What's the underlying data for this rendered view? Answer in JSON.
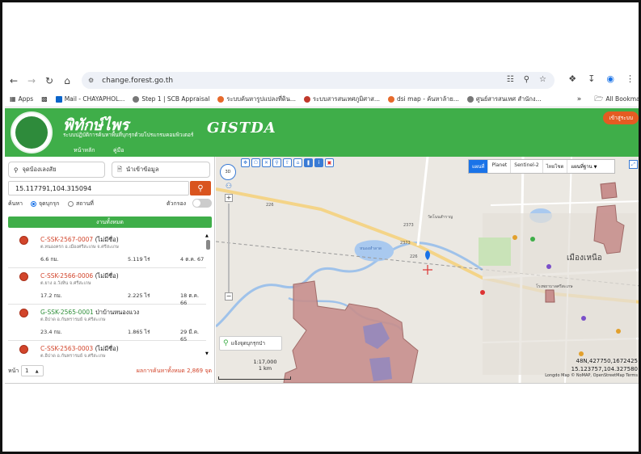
{
  "browser": {
    "url": "change.forest.go.th",
    "bookmarks": [
      {
        "label": "Apps"
      },
      {
        "label": "Mail - CHAYAPHOL..."
      },
      {
        "label": "Step 1 | SCB Appraisal"
      },
      {
        "label": "ระบบค้นหารูปแปลงที่ดิน..."
      },
      {
        "label": "ระบบสารสนเทศภูมิศาส..."
      },
      {
        "label": "dsi map - ค้นหาล้าย..."
      },
      {
        "label": "ศูนย์สารสนเทศ สำนักง..."
      }
    ],
    "all_bookmarks": "All Bookmarks"
  },
  "app": {
    "title": "พิทักษ์ไพร",
    "subtitle": "ระบบปฏิบัติการค้นหาพื้นที่บุกรุกด้วยโปรแกรมคอมพิวเตอร์",
    "partner": "GISTDA",
    "login": "เข้าสู่ระบบ",
    "tabs": {
      "main": "หน้าหลัก",
      "manual": "คู่มือ"
    }
  },
  "panel": {
    "subtab_location": "จุดบ้องเลงสัย",
    "subtab_import": "นำเข้าข้อมูล",
    "coord_value": "15.117791,104.315094",
    "search_label": "ค้นหา",
    "radio_point": "จุดบุกรุก",
    "radio_place": "สถานที่",
    "toggle_label": "ตัวกรอง",
    "all_button": "งานทั้งหมด",
    "results": [
      {
        "code": "C-SSK-2567-0007",
        "name": " (ไม่มีชื่อ)",
        "location": "ต.หนองครก อ.เมืองศรีสะเกษ จ.ศรีสะเกษ",
        "distance": "6.6 กม.",
        "area": "5.119 ไร่",
        "date": "4 ต.ค. 67",
        "type": "c"
      },
      {
        "code": "C-SSK-2566-0006",
        "name": " (ไม่มีชื่อ)",
        "location": "ต.ยาง อ.วังหิน จ.ศรีสะเกษ",
        "distance": "17.2 กม.",
        "area": "2.225 ไร่",
        "date": "18 ต.ค. 66",
        "type": "c"
      },
      {
        "code": "G-SSK-2565-0001",
        "name": " ป่าบ้านหนองแวง",
        "location": "ต.อีปาด อ.กันทรารมย์ จ.ศรีสะเกษ",
        "distance": "23.4 กม.",
        "area": "1.865 ไร่",
        "date": "29 มี.ค. 65",
        "type": "g"
      },
      {
        "code": "C-SSK-2563-0003",
        "name": " (ไม่มีชื่อ)",
        "location": "ต.อีปาด อ.กันทรารมย์ จ.ศรีสะเกษ",
        "distance": "",
        "area": "",
        "date": "",
        "type": "c"
      }
    ],
    "page_label": "หน้า",
    "page_value": "1",
    "total": "ผลการค้นหาทั้งหมด 2,869 จุด"
  },
  "map": {
    "basemaps": [
      "แผนที่",
      "Planet",
      "Sentinel-2",
      "ไทยโชต"
    ],
    "basemap_select": "แผนที่ฐาน",
    "compass": "3D",
    "current_location": "แจ้งจุดบุกรุกป่า",
    "scale": "1:17,000",
    "scale_distance": "1 km",
    "coord_utm": "48N,427750,1672425",
    "coord_latlon": "15.123757,104.327580",
    "attribution": "Longdo Map © NoMAP, OpenStreetMap Terms",
    "labels": [
      "วัดโนนสำราญ",
      "หนองสำลาด",
      "2373",
      "2373",
      "226",
      "226",
      "เมืองเหนือ",
      "โรงพยาบาลศรีสะเกษ"
    ]
  }
}
